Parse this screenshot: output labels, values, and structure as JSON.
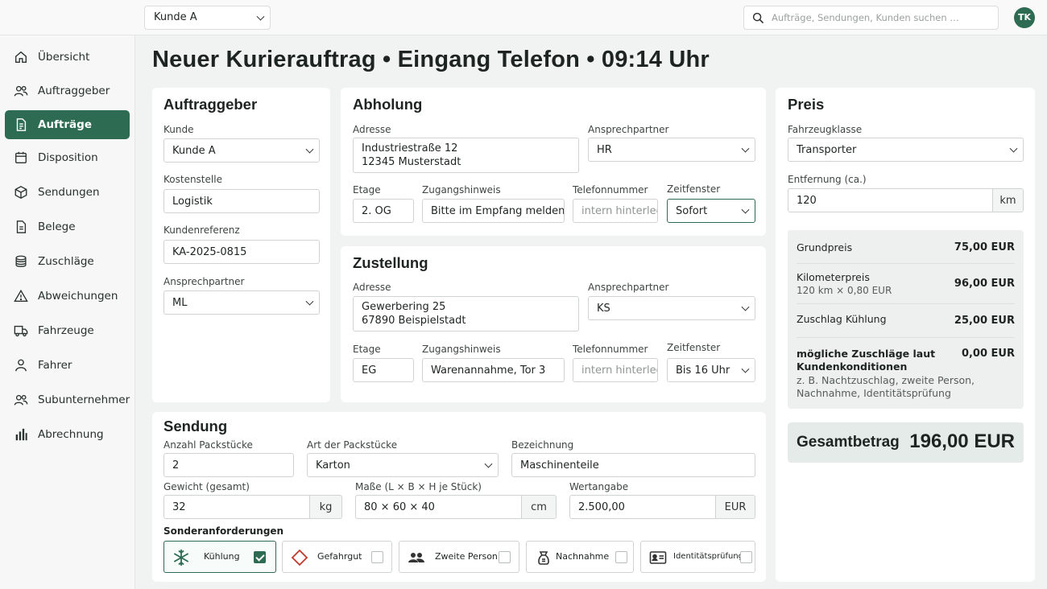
{
  "topbar": {
    "customer_select": "Kunde A",
    "search_placeholder": "Aufträge, Sendungen, Kunden suchen …",
    "avatar": "TK"
  },
  "sidebar": {
    "items": [
      {
        "label": "Übersicht",
        "icon": "home-icon"
      },
      {
        "label": "Auftraggeber",
        "icon": "users-icon"
      },
      {
        "label": "Aufträge",
        "icon": "document-icon",
        "active": true
      },
      {
        "label": "Disposition",
        "icon": "calendar-icon"
      },
      {
        "label": "Sendungen",
        "icon": "package-icon"
      },
      {
        "label": "Belege",
        "icon": "receipt-icon"
      },
      {
        "label": "Zuschläge",
        "icon": "coins-icon"
      },
      {
        "label": "Abweichungen",
        "icon": "warning-icon"
      },
      {
        "label": "Fahrzeuge",
        "icon": "truck-icon"
      },
      {
        "label": "Fahrer",
        "icon": "person-icon"
      },
      {
        "label": "Subunternehmer",
        "icon": "group-icon"
      },
      {
        "label": "Abrechnung",
        "icon": "bar-chart-icon"
      }
    ]
  },
  "page_title": "Neuer Kurierauftrag • Eingang Telefon • 09:14 Uhr",
  "auftraggeber": {
    "title": "Auftraggeber",
    "kunde_label": "Kunde",
    "kunde_value": "Kunde A",
    "kostenstelle_label": "Kostenstelle",
    "kostenstelle_value": "Logistik",
    "kundenreferenz_label": "Kundenreferenz",
    "kundenreferenz_value": "KA-2025-0815",
    "ansprechpartner_label": "Ansprechpartner",
    "ansprechpartner_value": "ML"
  },
  "abholung": {
    "title": "Abholung",
    "adresse_label": "Adresse",
    "adresse_line1": "Industriestraße 12",
    "adresse_line2": "12345 Musterstadt",
    "ansprechpartner_label": "Ansprechpartner",
    "ansprechpartner_value": "HR",
    "etage_label": "Etage",
    "etage_value": "2. OG",
    "zugangshinweis_label": "Zugangshinweis",
    "zugangshinweis_value": "Bitte im Empfang melden",
    "telefon_label": "Telefonnummer",
    "telefon_value": "intern hinterlegt",
    "zeitfenster_label": "Zeitfenster",
    "zeitfenster_value": "Sofort"
  },
  "zustellung": {
    "title": "Zustellung",
    "adresse_label": "Adresse",
    "adresse_line1": "Gewerbering 25",
    "adresse_line2": "67890 Beispielstadt",
    "ansprechpartner_label": "Ansprechpartner",
    "ansprechpartner_value": "KS",
    "etage_label": "Etage",
    "etage_value": "EG",
    "zugangshinweis_label": "Zugangshinweis",
    "zugangshinweis_value": "Warenannahme, Tor 3",
    "telefon_label": "Telefonnummer",
    "telefon_value": "intern hinterlegt",
    "zeitfenster_label": "Zeitfenster",
    "zeitfenster_value": "Bis 16 Uhr"
  },
  "sendung": {
    "title": "Sendung",
    "anzahl_label": "Anzahl Packstücke",
    "anzahl_value": "2",
    "art_label": "Art der Packstücke",
    "art_value": "Karton",
    "bezeichnung_label": "Bezeichnung",
    "bezeichnung_value": "Maschinenteile",
    "gewicht_label": "Gewicht (gesamt)",
    "gewicht_value": "32",
    "gewicht_unit": "kg",
    "masse_label": "Maße (L × B × H je Stück)",
    "masse_value": "80 × 60 × 40",
    "masse_unit": "cm",
    "wert_label": "Wertangabe",
    "wert_value": "2.500,00",
    "wert_unit": "EUR",
    "sonder_label": "Sonderanforderungen",
    "options": [
      {
        "label": "Kühlung",
        "icon": "snowflake-icon",
        "checked": true
      },
      {
        "label": "Gefahrgut",
        "icon": "hazard-diamond-icon",
        "checked": false
      },
      {
        "label": "Zweite Person",
        "icon": "two-persons-icon",
        "checked": false
      },
      {
        "label": "Nachnahme",
        "icon": "cash-icon",
        "checked": false
      },
      {
        "label": "Identitätsprüfung",
        "icon": "id-card-icon",
        "checked": false
      }
    ]
  },
  "preis": {
    "title": "Preis",
    "fahrzeugklasse_label": "Fahrzeugklasse",
    "fahrzeugklasse_value": "Transporter",
    "entfernung_label": "Entfernung (ca.)",
    "entfernung_value": "120",
    "entfernung_unit": "km",
    "grundpreis_label": "Grundpreis",
    "grundpreis_value": "75,00 EUR",
    "km_label": "Kilometerpreis",
    "km_sub": "120 km × 0,80 EUR",
    "km_value": "96,00 EUR",
    "kuehlung_label": "Zuschlag Kühlung",
    "kuehlung_value": "25,00 EUR",
    "moeglich_line1": "mögliche Zuschläge laut",
    "moeglich_line2": "Kundenkonditionen",
    "moeglich_value": "0,00 EUR",
    "moeglich_sub1": "z. B. Nachtzuschlag, zweite Person,",
    "moeglich_sub2": "Nachnahme, Identitätsprüfung",
    "gesamt_label": "Gesamtbetrag",
    "gesamt_value": "196,00 EUR"
  }
}
